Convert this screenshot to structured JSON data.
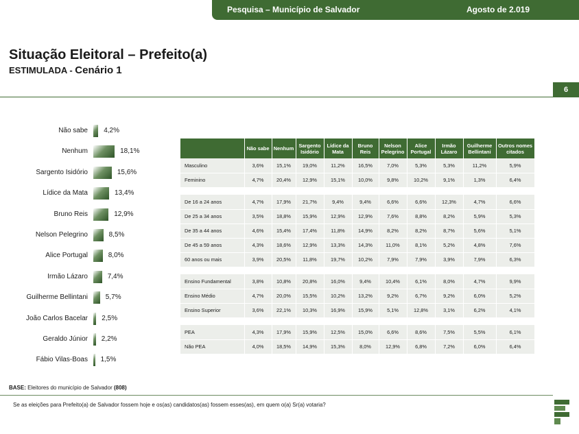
{
  "header": {
    "left": "Pesquisa – Município de Salvador",
    "right": "Agosto de 2.019"
  },
  "title": "Situação Eleitoral – Prefeito(a)",
  "subtitle_a": "ESTIMULADA - ",
  "subtitle_b": "Cenário 1",
  "page_number": "6",
  "chart_data": {
    "type": "bar",
    "orientation": "horizontal",
    "categories": [
      "Não sabe",
      "Nenhum",
      "Sargento Isidório",
      "Lídice da Mata",
      "Bruno Reis",
      "Nelson Pelegrino",
      "Alice Portugal",
      "Irmão Lázaro",
      "Guilherme Bellintani",
      "João Carlos Bacelar",
      "Geraldo Júnior",
      "Fábio Vilas-Boas"
    ],
    "values": [
      4.2,
      18.1,
      15.6,
      13.4,
      12.9,
      8.5,
      8.0,
      7.4,
      5.7,
      2.5,
      2.2,
      1.5
    ],
    "value_labels": [
      "4,2%",
      "18,1%",
      "15,6%",
      "13,4%",
      "12,9%",
      "8,5%",
      "8,0%",
      "7,4%",
      "5,7%",
      "2,5%",
      "2,2%",
      "1,5%"
    ],
    "title": "",
    "xlabel": "",
    "ylabel": ""
  },
  "table": {
    "columns": [
      "Não sabe",
      "Nenhum",
      "Sargento Isidório",
      "Lídice da Mata",
      "Bruno Reis",
      "Nelson Pelegrino",
      "Alice Portugal",
      "Irmão Lázaro",
      "Guilherme Bellintani",
      "Outros nomes citados"
    ],
    "groups": [
      [
        {
          "label": "Masculino",
          "values": [
            "3,6%",
            "15,1%",
            "19,0%",
            "11,2%",
            "16,5%",
            "7,0%",
            "5,3%",
            "5,3%",
            "11,2%",
            "5,9%"
          ]
        },
        {
          "label": "Feminino",
          "values": [
            "4,7%",
            "20,4%",
            "12,9%",
            "15,1%",
            "10,0%",
            "9,8%",
            "10,2%",
            "9,1%",
            "1,3%",
            "6,4%"
          ]
        }
      ],
      [
        {
          "label": "De 16 a 24 anos",
          "values": [
            "4,7%",
            "17,9%",
            "21,7%",
            "9,4%",
            "9,4%",
            "6,6%",
            "6,6%",
            "12,3%",
            "4,7%",
            "6,6%"
          ]
        },
        {
          "label": "De 25 a 34 anos",
          "values": [
            "3,5%",
            "18,8%",
            "15,9%",
            "12,9%",
            "12,9%",
            "7,6%",
            "8,8%",
            "8,2%",
            "5,9%",
            "5,3%"
          ]
        },
        {
          "label": "De 35 a 44 anos",
          "values": [
            "4,6%",
            "15,4%",
            "17,4%",
            "11,8%",
            "14,9%",
            "8,2%",
            "8,2%",
            "8,7%",
            "5,6%",
            "5,1%"
          ]
        },
        {
          "label": "De 45 a 59 anos",
          "values": [
            "4,3%",
            "18,6%",
            "12,9%",
            "13,3%",
            "14,3%",
            "11,0%",
            "8,1%",
            "5,2%",
            "4,8%",
            "7,6%"
          ]
        },
        {
          "label": "60 anos ou mais",
          "values": [
            "3,9%",
            "20,5%",
            "11,8%",
            "19,7%",
            "10,2%",
            "7,9%",
            "7,9%",
            "3,9%",
            "7,9%",
            "6,3%"
          ]
        }
      ],
      [
        {
          "label": "Ensino Fundamental",
          "values": [
            "3,8%",
            "10,8%",
            "20,8%",
            "16,0%",
            "9,4%",
            "10,4%",
            "6,1%",
            "8,0%",
            "4,7%",
            "9,9%"
          ]
        },
        {
          "label": "Ensino Médio",
          "values": [
            "4,7%",
            "20,0%",
            "15,5%",
            "10,2%",
            "13,2%",
            "9,2%",
            "6,7%",
            "9,2%",
            "6,0%",
            "5,2%"
          ]
        },
        {
          "label": "Ensino Superior",
          "values": [
            "3,6%",
            "22,1%",
            "10,3%",
            "16,9%",
            "15,9%",
            "5,1%",
            "12,8%",
            "3,1%",
            "6,2%",
            "4,1%"
          ]
        }
      ],
      [
        {
          "label": "PEA",
          "values": [
            "4,3%",
            "17,9%",
            "15,9%",
            "12,5%",
            "15,0%",
            "6,6%",
            "8,6%",
            "7,5%",
            "5,5%",
            "6,1%"
          ]
        },
        {
          "label": "Não PEA",
          "values": [
            "4,0%",
            "18,5%",
            "14,9%",
            "15,3%",
            "8,0%",
            "12,9%",
            "6,8%",
            "7,2%",
            "6,0%",
            "6,4%"
          ]
        }
      ]
    ]
  },
  "base": {
    "label": "BASE:",
    "text": " Eleitores do município de Salvador ",
    "count": "(808)"
  },
  "question": "Se as eleições para Prefeito(a) de Salvador fossem hoje e os(as) candidatos(as) fossem esses(as), em quem o(a) Sr(a) votaria?"
}
